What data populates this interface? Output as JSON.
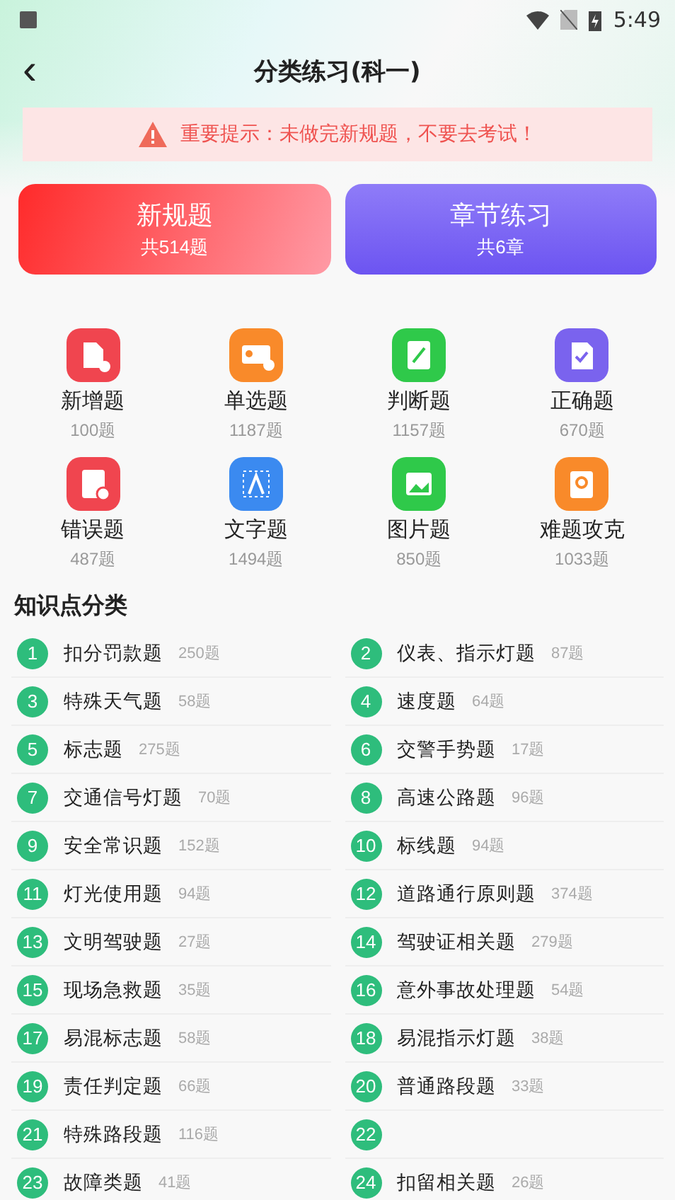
{
  "status_bar": {
    "time": "5:49"
  },
  "header": {
    "back": "‹",
    "title": "分类练习(科一)"
  },
  "notice": {
    "text": "重要提示：未做完新规题，不要去考试！"
  },
  "big_buttons": [
    {
      "kind": "red",
      "title": "新规题",
      "subtitle": "共514题"
    },
    {
      "kind": "purple",
      "title": "章节练习",
      "subtitle": "共6章"
    }
  ],
  "categories": [
    {
      "kind": "new",
      "color": "#f0454f",
      "label": "新增题",
      "count": "100题"
    },
    {
      "kind": "single",
      "color": "#f98a2a",
      "label": "单选题",
      "count": "1187题"
    },
    {
      "kind": "judge",
      "color": "#2fc94a",
      "label": "判断题",
      "count": "1157题"
    },
    {
      "kind": "correct",
      "color": "#7a63ee",
      "label": "正确题",
      "count": "670题"
    },
    {
      "kind": "wrong",
      "color": "#f0454f",
      "label": "错误题",
      "count": "487题"
    },
    {
      "kind": "text",
      "color": "#3b8af0",
      "label": "文字题",
      "count": "1494题"
    },
    {
      "kind": "image",
      "color": "#2fc94a",
      "label": "图片题",
      "count": "850题"
    },
    {
      "kind": "hard",
      "color": "#f98a2a",
      "label": "难题攻克",
      "count": "1033题"
    }
  ],
  "section_title": "知识点分类",
  "topics": [
    {
      "number": "1",
      "label": "扣分罚款题",
      "count": "250题"
    },
    {
      "number": "2",
      "label": "仪表、指示灯题",
      "count": "87题"
    },
    {
      "number": "3",
      "label": "特殊天气题",
      "count": "58题"
    },
    {
      "number": "4",
      "label": "速度题",
      "count": "64题"
    },
    {
      "number": "5",
      "label": "标志题",
      "count": "275题"
    },
    {
      "number": "6",
      "label": "交警手势题",
      "count": "17题"
    },
    {
      "number": "7",
      "label": "交通信号灯题",
      "count": "70题"
    },
    {
      "number": "8",
      "label": "高速公路题",
      "count": "96题"
    },
    {
      "number": "9",
      "label": "安全常识题",
      "count": "152题"
    },
    {
      "number": "10",
      "label": "标线题",
      "count": "94题"
    },
    {
      "number": "11",
      "label": "灯光使用题",
      "count": "94题"
    },
    {
      "number": "12",
      "label": "道路通行原则题",
      "count": "374题"
    },
    {
      "number": "13",
      "label": "文明驾驶题",
      "count": "27题"
    },
    {
      "number": "14",
      "label": "驾驶证相关题",
      "count": "279题"
    },
    {
      "number": "15",
      "label": "现场急救题",
      "count": "35题"
    },
    {
      "number": "16",
      "label": "意外事故处理题",
      "count": "54题"
    },
    {
      "number": "17",
      "label": "易混标志题",
      "count": "58题"
    },
    {
      "number": "18",
      "label": "易混指示灯题",
      "count": "38题"
    },
    {
      "number": "19",
      "label": "责任判定题",
      "count": "66题"
    },
    {
      "number": "20",
      "label": "普通路段题",
      "count": "33题"
    },
    {
      "number": "21",
      "label": "特殊路段题",
      "count": "116题"
    },
    {
      "number": "22"
    },
    {
      "number": "23",
      "label": "故障类题",
      "count": "41题"
    },
    {
      "number": "24",
      "label": "扣留相关题",
      "count": "26题"
    }
  ]
}
